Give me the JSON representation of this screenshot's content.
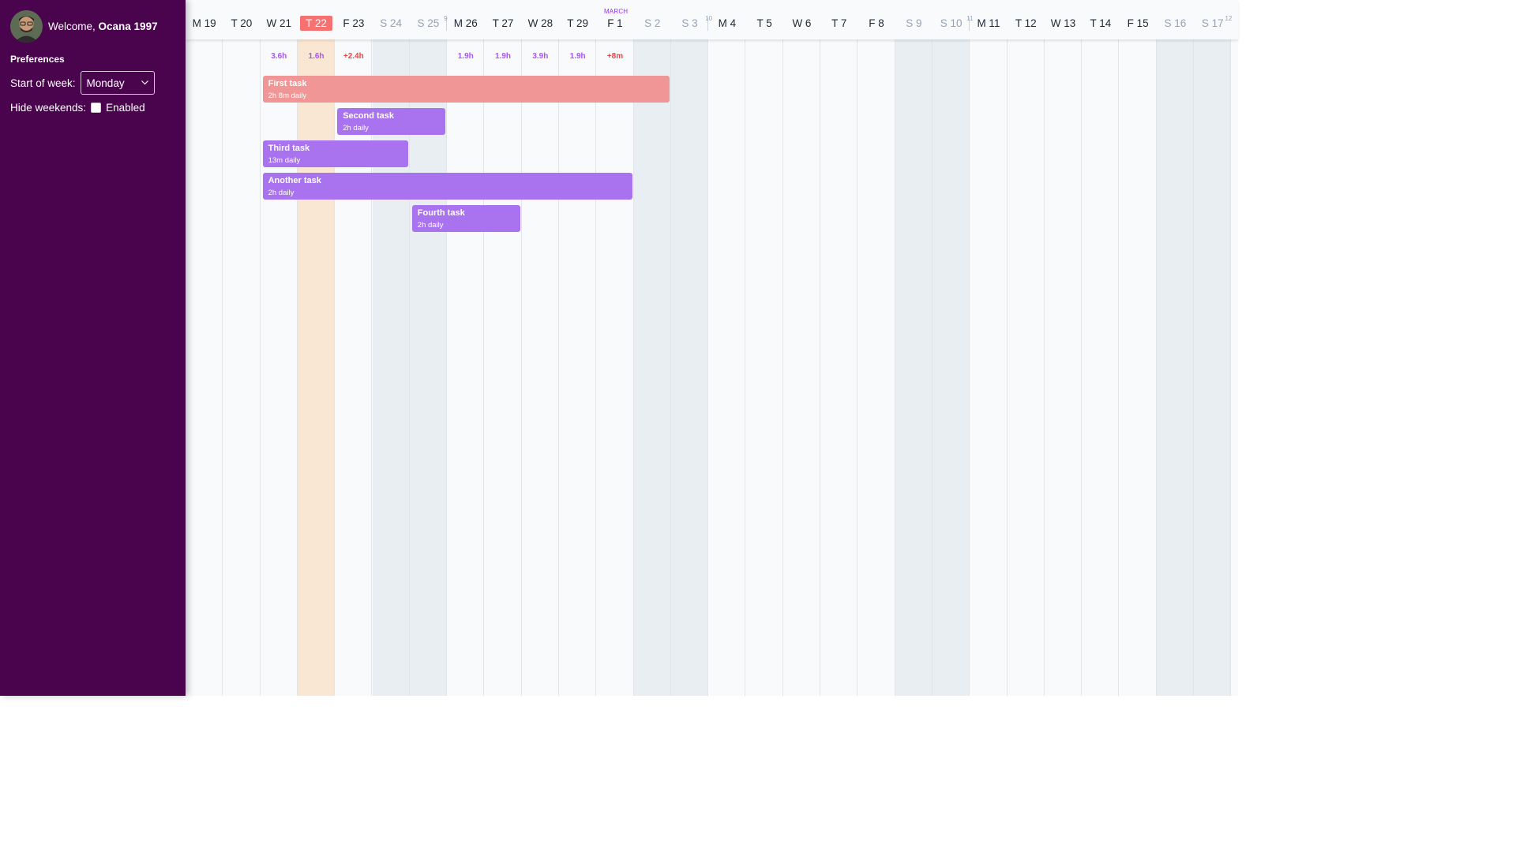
{
  "sidebar": {
    "welcome_prefix": "Welcome, ",
    "user_name": "Ocana 1997",
    "preferences_title": "Preferences",
    "start_of_week_label": "Start of week:",
    "start_of_week_value": "Monday",
    "hide_weekends_label": "Hide weekends:",
    "hide_weekends_option": "Enabled",
    "hide_weekends_checked": false
  },
  "calendar": {
    "month_label": "MARCH",
    "week_numbers": [
      "9",
      "10",
      "11",
      "12"
    ],
    "days": [
      {
        "label": "M 19"
      },
      {
        "label": "T 20"
      },
      {
        "label": "W 21"
      },
      {
        "label": "T 22"
      },
      {
        "label": "F 23"
      },
      {
        "label": "S 24"
      },
      {
        "label": "S 25"
      },
      {
        "label": "M 26"
      },
      {
        "label": "T 27"
      },
      {
        "label": "W 28"
      },
      {
        "label": "T 29"
      },
      {
        "label": "F 1"
      },
      {
        "label": "S 2"
      },
      {
        "label": "S 3"
      },
      {
        "label": "M 4"
      },
      {
        "label": "T 5"
      },
      {
        "label": "W 6"
      },
      {
        "label": "T 7"
      },
      {
        "label": "F 8"
      },
      {
        "label": "S 9"
      },
      {
        "label": "S 10"
      },
      {
        "label": "M 11"
      },
      {
        "label": "T 12"
      },
      {
        "label": "W 13"
      },
      {
        "label": "T 14"
      },
      {
        "label": "F 15"
      },
      {
        "label": "S 16"
      },
      {
        "label": "S 17"
      }
    ],
    "today": "T 22",
    "hours": [
      {
        "day": "W 21",
        "value": "3.6h",
        "tone": "purple"
      },
      {
        "day": "T 22",
        "value": "1.6h",
        "tone": "purple"
      },
      {
        "day": "F 23",
        "value": "+2.4h",
        "tone": "red"
      },
      {
        "day": "M 26",
        "value": "1.9h",
        "tone": "purple"
      },
      {
        "day": "T 27",
        "value": "1.9h",
        "tone": "purple"
      },
      {
        "day": "W 28",
        "value": "3.9h",
        "tone": "purple"
      },
      {
        "day": "T 29",
        "value": "1.9h",
        "tone": "purple"
      },
      {
        "day": "F 1",
        "value": "+8m",
        "tone": "red"
      }
    ],
    "tasks": [
      {
        "name": "First task",
        "detail": "2h 8m daily",
        "start": "W 21",
        "end": "S 2",
        "color": "red"
      },
      {
        "name": "Second task",
        "detail": "2h daily",
        "start": "F 23",
        "end": "S 25",
        "color": "purple"
      },
      {
        "name": "Third task",
        "detail": "13m daily",
        "start": "W 21",
        "end": "S 24",
        "color": "purple"
      },
      {
        "name": "Another task",
        "detail": "2h daily",
        "start": "W 21",
        "end": "F 1",
        "color": "purple"
      },
      {
        "name": "Fourth task",
        "detail": "2h daily",
        "start": "S 25",
        "end": "T 27",
        "color": "purple"
      }
    ]
  },
  "colors": {
    "sidebar_bg": "#4a044e",
    "today_badge": "#f87171",
    "today_column": "#fae7d3",
    "task_red": "#f09696",
    "task_purple": "#a973f0",
    "hours_purple": "#a855f7",
    "hours_red": "#ef4444"
  }
}
